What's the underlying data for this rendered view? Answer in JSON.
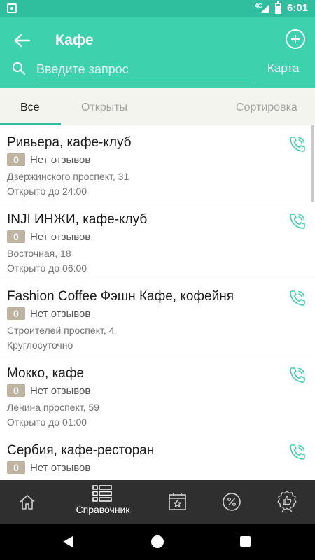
{
  "status_bar": {
    "time": "6:01",
    "network": "4G"
  },
  "header": {
    "title": "Кафе",
    "search_placeholder": "Введите запрос",
    "map_label": "Карта"
  },
  "tabs": {
    "all": "Все",
    "open": "Открыты",
    "sort": "Сортировка",
    "active": "all"
  },
  "colors": {
    "accent": "#3dd1ae",
    "status_bar": "#2fbf9e",
    "badge": "#bfb4a0",
    "nav_bg": "#2f2f2f"
  },
  "places": [
    {
      "name": "Ривьера, кафе-клуб",
      "rating": "0",
      "reviews": "Нет отзывов",
      "address": "Дзержинского проспект, 31",
      "hours": "Открыто до 24:00"
    },
    {
      "name": "INJI ИНЖИ, кафе-клуб",
      "rating": "0",
      "reviews": "Нет отзывов",
      "address": "Восточная, 18",
      "hours": "Открыто до 06:00"
    },
    {
      "name": "Fashion Coffee Фэшн Кафе, кофейня",
      "rating": "0",
      "reviews": "Нет отзывов",
      "address": "Строителей проспект, 4",
      "hours": "Круглосуточно"
    },
    {
      "name": "Мокко, кафе",
      "rating": "0",
      "reviews": "Нет отзывов",
      "address": "Ленина проспект, 59",
      "hours": "Открыто до 01:00"
    },
    {
      "name": "Сербия, кафе-ресторан",
      "rating": "0",
      "reviews": "Нет отзывов",
      "address": "",
      "hours": ""
    }
  ],
  "bottom_nav": {
    "home_icon": "home-icon",
    "directory_label": "Справочник",
    "directory_icon": "list-icon",
    "events_icon": "calendar-star-icon",
    "discounts_icon": "percent-icon",
    "awards_icon": "badge-thumbs-up-icon"
  }
}
